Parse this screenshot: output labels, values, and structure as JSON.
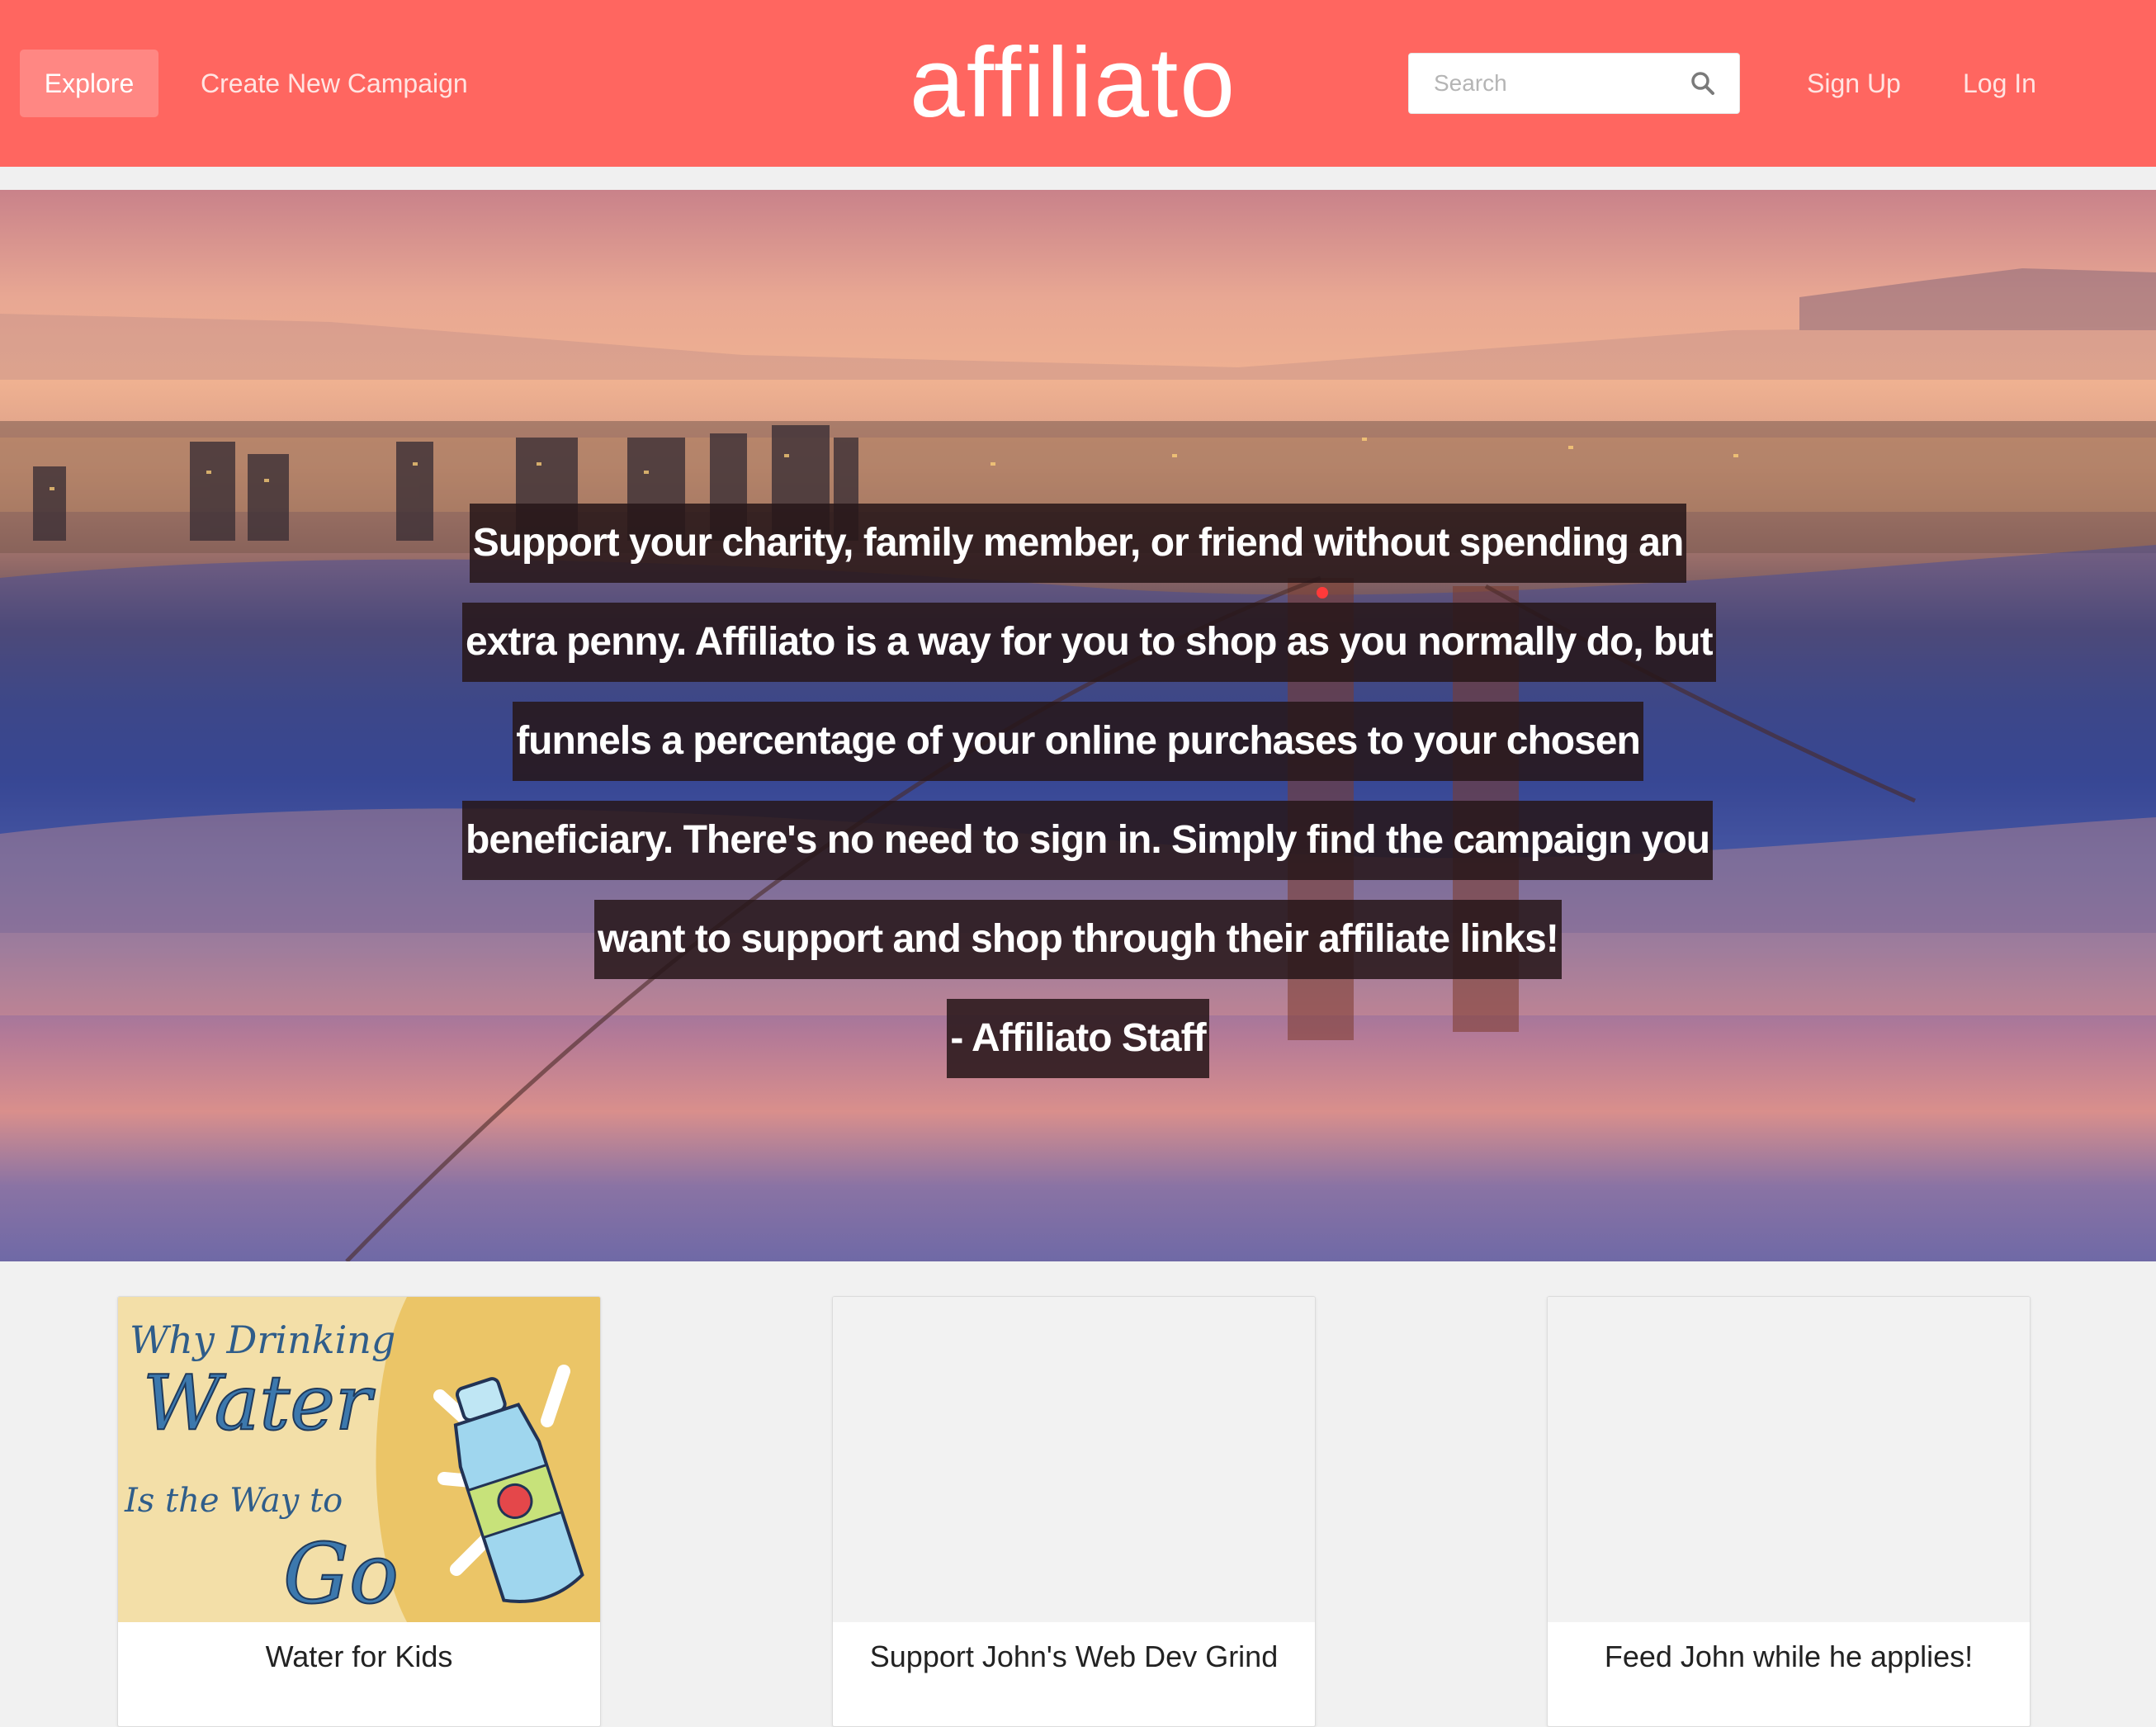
{
  "nav": {
    "explore_label": "Explore",
    "create_campaign_label": "Create New Campaign",
    "brand": "affiliato",
    "search_placeholder": "Search",
    "signup_label": "Sign Up",
    "login_label": "Log In"
  },
  "hero": {
    "quote_lines": [
      "Support your charity, family member, or friend without spending an",
      "extra penny. Affiliato is a way for you to shop as you normally do, but",
      "funnels a percentage of your online purchases to your chosen",
      "beneficiary. There's no need to sign in. Simply find the campaign you",
      "want to support and shop through their affiliate links!"
    ],
    "attribution": "- Affiliato Staff"
  },
  "campaigns": [
    {
      "title": "Water for Kids",
      "image_text": [
        "Why Drinking",
        "Water",
        "Is the Way to",
        "Go"
      ]
    },
    {
      "title": "Support John's Web Dev Grind"
    },
    {
      "title": "Feed John while he applies!"
    }
  ],
  "colors": {
    "header": "#ff6660",
    "explore_active": "#ff8783",
    "page_bg": "#f1f1f1"
  }
}
